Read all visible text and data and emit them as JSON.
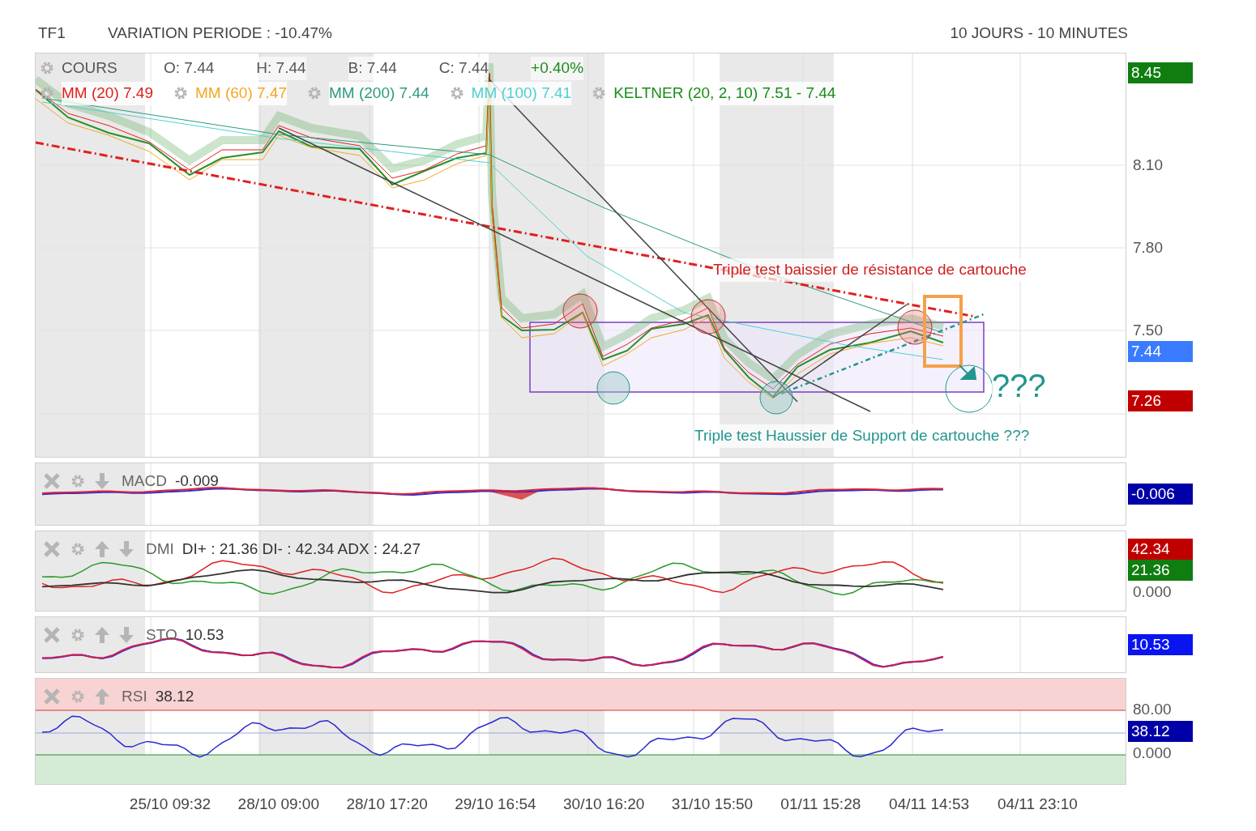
{
  "header": {
    "symbol": "TF1",
    "variation": "VARIATION PERIODE : -10.47%",
    "period": "10 JOURS - 10 MINUTES"
  },
  "main": {
    "title": "COURS",
    "ohlc": [
      {
        "text": "O: 7.44",
        "color": "#555555"
      },
      {
        "text": "H: 7.44",
        "color": "#555555"
      },
      {
        "text": "B: 7.44",
        "color": "#555555"
      },
      {
        "text": "C: 7.44",
        "color": "#555555"
      },
      {
        "text": "+0.40%",
        "color": "#1a8c1a"
      }
    ],
    "overlays": [
      {
        "label": "MM (20)",
        "value": "7.49",
        "color": "#e0201c"
      },
      {
        "label": "MM (60)",
        "value": "7.47",
        "color": "#f5a623"
      },
      {
        "label": "MM (200)",
        "value": "7.44",
        "color": "#2e9a7e"
      },
      {
        "label": "MM (100)",
        "value": "7.41",
        "color": "#4fd0d0"
      },
      {
        "label": "KELTNER (20, 2, 10)",
        "value": "7.51 - 7.44",
        "color": "#1a8c1a"
      }
    ],
    "annotations": [
      {
        "kind": "resistance",
        "text": "Triple test baissier de résistance de cartouche",
        "color": "#d21d1d"
      },
      {
        "kind": "question",
        "text": "???",
        "color": "#23958e"
      },
      {
        "kind": "support",
        "text": "Triple test Haussier de Support de cartouche ???",
        "color": "#23958e"
      }
    ],
    "y_labels": [
      "8.10",
      "7.80",
      "7.50"
    ],
    "badges": [
      {
        "text": "8.45",
        "color": "#0f7d0f"
      },
      {
        "text": "7.44",
        "color": "#3b7bff"
      },
      {
        "text": "7.26",
        "color": "#c00000"
      }
    ]
  },
  "indicators": [
    {
      "kind": "macd",
      "name": "MACD",
      "value": "-0.009",
      "move_up": false,
      "move_down": true,
      "badges": [
        {
          "text": "-0.006",
          "color": "#0000a8"
        }
      ]
    },
    {
      "kind": "dmi",
      "name": "DMI",
      "value": "DI+ : 21.36 DI- : 42.34 ADX : 24.27",
      "move_up": true,
      "move_down": true,
      "badges": [
        {
          "text": "42.34",
          "color": "#c00000"
        },
        {
          "text": "21.36",
          "color": "#0f7d0f"
        }
      ],
      "labels": [
        "0.000"
      ]
    },
    {
      "kind": "sto",
      "name": "STO",
      "value": "10.53",
      "move_up": true,
      "move_down": true,
      "badges": [
        {
          "text": "10.53",
          "color": "#0a14f0"
        }
      ]
    },
    {
      "kind": "rsi",
      "name": "RSI",
      "value": "38.12",
      "move_up": true,
      "move_down": false,
      "badges": [
        {
          "text": "38.12",
          "color": "#0000a8"
        }
      ],
      "labels": [
        "80.00",
        "0.000"
      ]
    }
  ],
  "x_labels": [
    "25/10 09:32",
    "28/10 09:00",
    "28/10 17:20",
    "29/10 16:54",
    "30/10 16:20",
    "31/10 15:50",
    "01/11 15:28",
    "04/11 14:53",
    "04/11 23:10"
  ]
}
